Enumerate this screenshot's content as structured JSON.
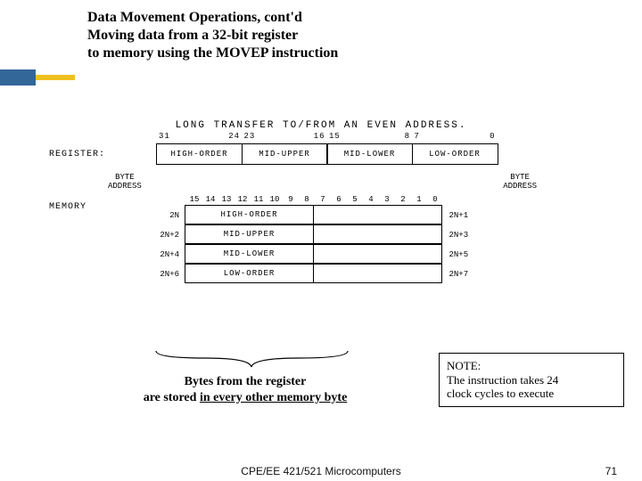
{
  "title": {
    "line1": "Data Movement Operations, cont'd",
    "line2": "Moving data from a 32-bit register",
    "line3": "to memory using the MOVEP instruction"
  },
  "diagram": {
    "caption": "LONG TRANSFER TO/FROM AN EVEN ADDRESS.",
    "register_label": "REGISTER:",
    "register_cells": [
      {
        "left": "31",
        "right": "24",
        "text": "HIGH-ORDER"
      },
      {
        "left": "23",
        "right": "16",
        "text": "MID-UPPER"
      },
      {
        "left": "15",
        "right": "8",
        "text": "MID-LOWER"
      },
      {
        "left": "7",
        "right": "0",
        "text": "LOW-ORDER"
      }
    ],
    "byte_addr_label": "BYTE\nADDRESS",
    "memory_label": "MEMORY",
    "mem_bit_header": [
      "15",
      "14",
      "13",
      "12",
      "11",
      "10",
      "9",
      "8",
      "7",
      "6",
      "5",
      "4",
      "3",
      "2",
      "1",
      "0"
    ],
    "mem_rows": [
      {
        "left": "2N",
        "cell_l": "HIGH-ORDER",
        "cell_r": "",
        "right": "2N+1"
      },
      {
        "left": "2N+2",
        "cell_l": "MID-UPPER",
        "cell_r": "",
        "right": "2N+3"
      },
      {
        "left": "2N+4",
        "cell_l": "MID-LOWER",
        "cell_r": "",
        "right": "2N+5"
      },
      {
        "left": "2N+6",
        "cell_l": "LOW-ORDER",
        "cell_r": "",
        "right": "2N+7"
      }
    ]
  },
  "caption_under_brace": {
    "line1": "Bytes from the register",
    "line2_prefix": "are stored ",
    "line2_underline": "in every other memory byte"
  },
  "note": {
    "heading": "NOTE:",
    "line2": "The instruction takes 24",
    "line3": "clock cycles to execute"
  },
  "footer": {
    "center": "CPE/EE 421/521 Microcomputers",
    "page": "71"
  }
}
